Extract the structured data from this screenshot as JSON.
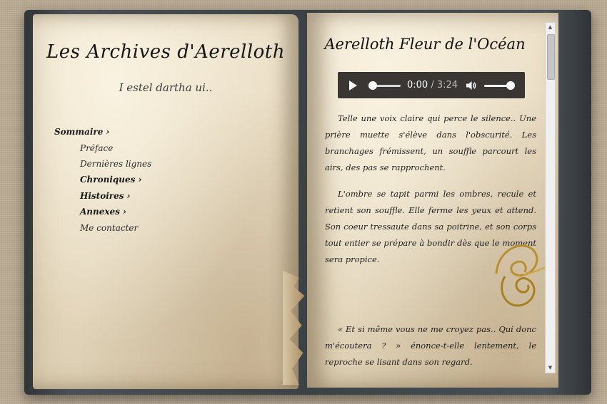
{
  "left_page": {
    "title": "Les Archives d'Aerelloth",
    "subtitle": "I estel dartha ui..",
    "menu": [
      {
        "label": "Sommaire ›",
        "level": 0,
        "bold": true
      },
      {
        "label": "Préface",
        "level": 1,
        "bold": false
      },
      {
        "label": "Dernières lignes",
        "level": 1,
        "bold": false
      },
      {
        "label": "Chroniques ›",
        "level": 1,
        "bold": true
      },
      {
        "label": "Histoires ›",
        "level": 1,
        "bold": true
      },
      {
        "label": "Annexes ›",
        "level": 1,
        "bold": true
      },
      {
        "label": "Me contacter",
        "level": 1,
        "bold": false
      }
    ]
  },
  "right_page": {
    "title": "Aerelloth Fleur de l'Océan",
    "audio": {
      "current_time": "0:00",
      "duration": "3:24",
      "separator": " / ",
      "progress_fraction": 0,
      "volume_fraction": 1
    },
    "paragraphs": [
      "Telle une voix claire qui perce le silence.. Une prière muette s'élève dans l'obscurité. Les branchages frémissent, un souffle parcourt les airs, des pas se rapprochent.",
      "L'ombre se tapit parmi les ombres, recule et retient son souffle. Elle ferme les yeux et attend. Son coeur tressaute dans sa poitrine, et son corps tout entier se prépare à bondir dès que le moment sera propice.",
      "« Et si même vous ne me croyez pas.. Qui donc m'écoutera ? » énonce-t-elle lentement, le reproche se lisant dans son regard."
    ]
  },
  "icons": {
    "play": "play-icon",
    "volume": "volume-icon",
    "ornament": "gold-swirl-divider",
    "scroll_up": "scroll-up-arrow-icon",
    "scroll_down": "scroll-down-arrow-icon"
  },
  "colors": {
    "page": "#e8dcc4",
    "cover": "#3b4246",
    "audio_bg": "#3a3634",
    "gold": "#b8912e",
    "text": "#1f1f1f"
  }
}
